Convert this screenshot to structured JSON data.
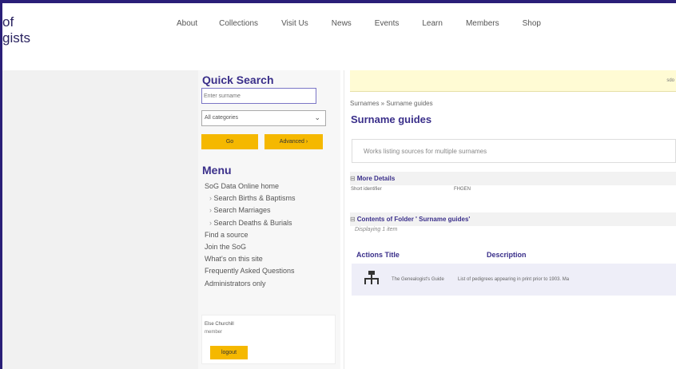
{
  "header": {
    "logo_line1": "of",
    "logo_line2": "gists",
    "nav": [
      "About",
      "Collections",
      "Visit Us",
      "News",
      "Events",
      "Learn",
      "Members",
      "Shop"
    ]
  },
  "quick_search": {
    "title": "Quick Search",
    "surname_placeholder": "Enter surname",
    "category_selected": "All categories",
    "go_label": "Go",
    "advanced_label": "Advanced ›"
  },
  "menu": {
    "title": "Menu",
    "items": [
      "SoG Data Online home",
      "Search Births & Baptisms",
      "Search Marriages",
      "Search Deaths & Burials",
      "Find a source",
      "Join the SoG",
      "What's on this site",
      "Frequently Asked Questions",
      "Administrators only"
    ]
  },
  "user": {
    "name": "Else Churchill",
    "role": "member",
    "logout_label": "logout"
  },
  "main": {
    "notice_text": "sdo",
    "breadcrumb": "Surnames » Surname guides",
    "title": "Surname guides",
    "description": "Works listing sources for multiple surnames",
    "more_details": {
      "header": "More Details",
      "label": "Short identifier",
      "value": "FHGEN"
    },
    "contents": {
      "header": "Contents of Folder ' Surname guides'",
      "displaying": "Displaying 1 item",
      "col_actions_title": "Actions Title",
      "col_description": "Description",
      "row_title": "The Genealogist's Guide",
      "row_description": "List of pedigrees appearing in print prior to 1903. Ma"
    }
  },
  "colors": {
    "frame": "#2a1f78",
    "accent": "#3a2f8a",
    "button": "#f5b800"
  }
}
